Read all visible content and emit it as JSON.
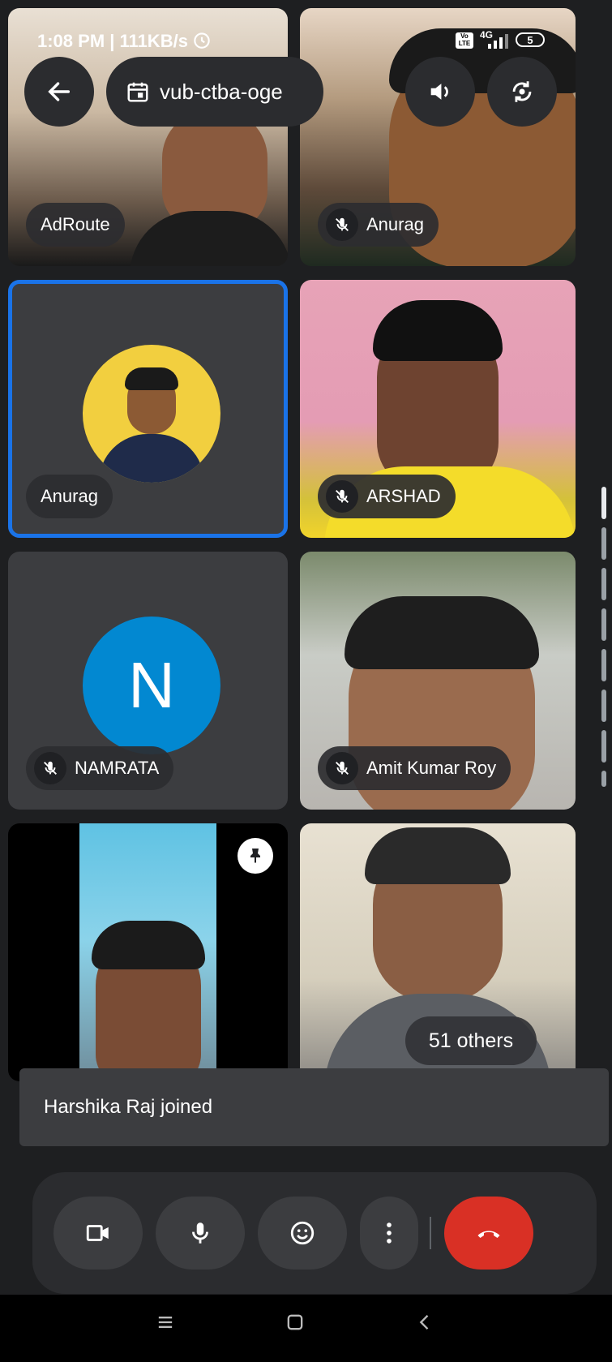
{
  "status_bar": {
    "time_text": "1:08 PM | 111KB/s",
    "network": "4G",
    "volte": "Vo LTE",
    "battery": "5"
  },
  "top_bar": {
    "meeting_code": "vub-ctba-oge",
    "icons": [
      "back-arrow-icon",
      "calendar-icon",
      "speaker-icon",
      "switch-camera-icon"
    ]
  },
  "participants": [
    {
      "name": "AdRoute",
      "muted": false,
      "type": "video"
    },
    {
      "name": "Anurag",
      "muted": true,
      "type": "video"
    },
    {
      "name": "Anurag",
      "muted": false,
      "type": "avatar-photo",
      "active_speaker": true
    },
    {
      "name": "ARSHAD",
      "muted": true,
      "type": "video"
    },
    {
      "name": "NAMRATA",
      "muted": true,
      "type": "avatar-letter",
      "initial": "N",
      "avatar_color": "#0288d1"
    },
    {
      "name": "Amit Kumar Roy",
      "muted": true,
      "type": "video"
    },
    {
      "name": "",
      "muted": false,
      "type": "video",
      "pinned_icon": "pin-icon"
    },
    {
      "name": "",
      "muted": false,
      "type": "video"
    }
  ],
  "others_badge": "51 others",
  "toast": "Harshika Raj joined",
  "controls": {
    "icons": [
      "camera-icon",
      "microphone-icon",
      "emoji-icon",
      "more-icon",
      "end-call-icon"
    ],
    "end_call_color": "#d93025"
  },
  "nav": [
    "menu-icon",
    "home-icon",
    "back-icon"
  ],
  "colors": {
    "active_outline": "#1a73e8",
    "tile_dark": "#3c3d40",
    "pill_bg": "#2c2d30"
  }
}
